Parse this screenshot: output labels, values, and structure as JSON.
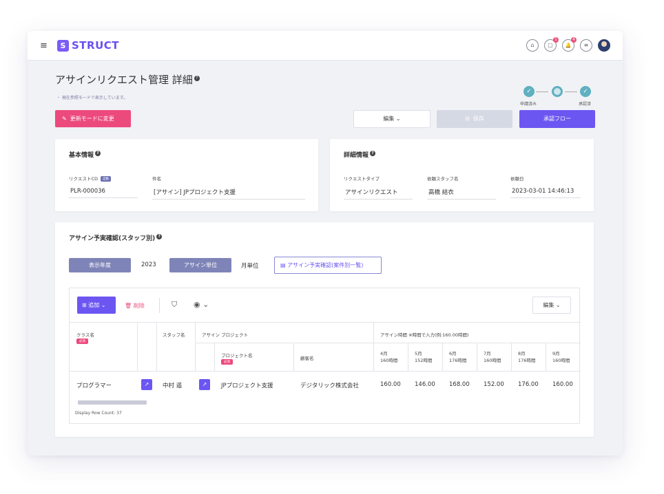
{
  "app": {
    "logo_mark": "S",
    "logo_text": "STRUCT",
    "menu_icon": "≡"
  },
  "header_icons": [
    {
      "name": "home-icon",
      "glyph": "⌂",
      "badge": ""
    },
    {
      "name": "chat-icon",
      "glyph": "▢",
      "badge": "1"
    },
    {
      "name": "bell-icon",
      "glyph": "🔔",
      "badge": "4"
    },
    {
      "name": "note-icon",
      "glyph": "≡",
      "badge": ""
    }
  ],
  "page": {
    "title": "アサインリクエスト管理 詳細",
    "help": "?",
    "mode_note": "・ 現在参照モードで表示しています。",
    "update_mode_button": "更新モードに変更",
    "edit_button": "編集 ⌄",
    "save_button": "保存",
    "save_icon": "⊟",
    "flow_button": "承認フロー"
  },
  "steps": [
    {
      "label": "申請済み",
      "status": "done"
    },
    {
      "label": "",
      "status": "current"
    },
    {
      "label": "承認済",
      "status": "done"
    }
  ],
  "basic_info": {
    "title": "基本情報",
    "request_cd_label": "リクエストCD",
    "auto_tag": "自動",
    "request_cd_value": "PLR-000036",
    "subject_label": "件名",
    "subject_value": "[アサイン] JPプロジェクト支援"
  },
  "detail_info": {
    "title": "詳細情報",
    "type_label": "リクエストタイプ",
    "type_value": "アサインリクエスト",
    "staff_label": "依頼スタッフ名",
    "staff_value": "高橋 結衣",
    "date_label": "依頼日",
    "date_value": "2023-03-01 14:46:13"
  },
  "assign": {
    "title": "アサイン予実確認(スタッフ別)",
    "year_label": "表示年度",
    "year_value": "2023",
    "unit_label": "アサイン単位",
    "unit_value": "月単位",
    "list_button": "アサイン予実確認(案件別一覧)",
    "add_button": "追加 ⌄",
    "delete_button": "削除",
    "grid_edit_button": "編集 ⌄",
    "row_count": "Display Row Count: 37",
    "required_tag": "必須",
    "headers": {
      "class": "クラス名",
      "staff": "スタッフ名",
      "project_group": "アサイン プロジェクト",
      "project": "プロジェクト名",
      "customer": "顧客名",
      "hours_group": "アサイン時間 ※時間で入力(例:160.00時間)"
    },
    "months": [
      {
        "month": "4月",
        "hours": "160時間"
      },
      {
        "month": "5月",
        "hours": "152時間"
      },
      {
        "month": "6月",
        "hours": "176時間"
      },
      {
        "month": "7月",
        "hours": "160時間"
      },
      {
        "month": "8月",
        "hours": "176時間"
      },
      {
        "month": "9月",
        "hours": "160時間"
      }
    ],
    "row": {
      "class": "プログラマー",
      "staff": "中村 遥",
      "project": "JPプロジェクト支援",
      "customer": "デジタリック株式会社",
      "values": [
        "160.00",
        "146.00",
        "168.00",
        "152.00",
        "176.00",
        "160.00"
      ]
    }
  }
}
